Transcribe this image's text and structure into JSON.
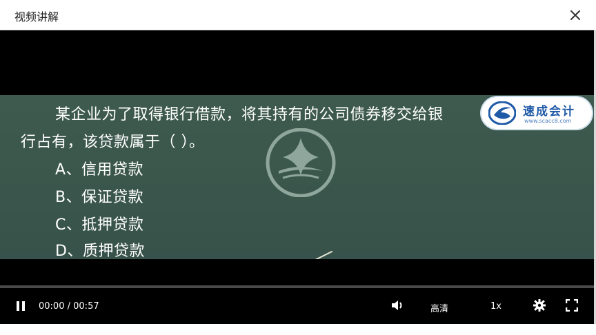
{
  "dialog": {
    "title": "视频讲解"
  },
  "question": {
    "line1": "某企业为了取得银行借款，将其持有的公司债券移交给银",
    "line2": "行占有，该贷款属于（      ）。",
    "options": [
      {
        "label": "A、信用贷款"
      },
      {
        "label": "B、保证贷款"
      },
      {
        "label": "C、抵押贷款"
      },
      {
        "label": "D、质押贷款"
      }
    ]
  },
  "brand": {
    "name": "速成会计",
    "url": "www.scacc8.com"
  },
  "player": {
    "current_time": "00:00",
    "separator": "/",
    "duration": "00:57",
    "progress": 0.0,
    "quality_label": "高清",
    "speed_label": "1x"
  },
  "colors": {
    "slide_bg": "#3b574c",
    "brand_blue": "#1f5aa8",
    "player_bg": "#000000"
  }
}
